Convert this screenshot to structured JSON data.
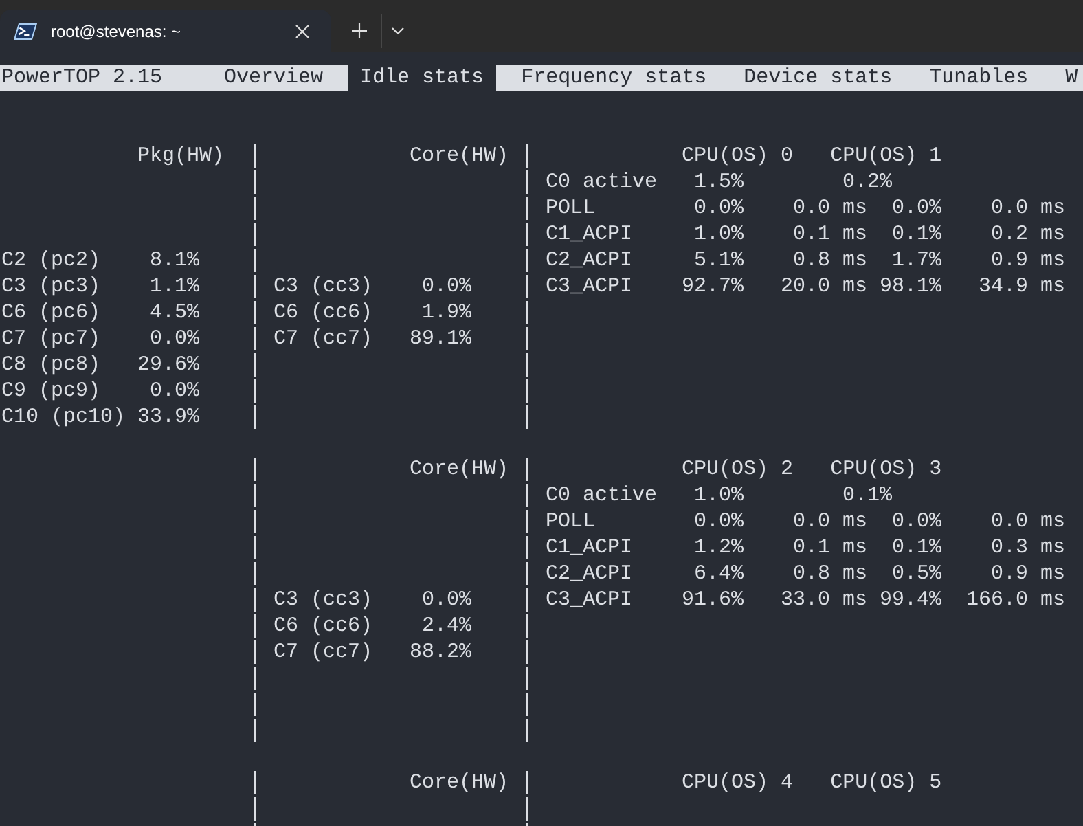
{
  "window": {
    "tabs": [
      {
        "title": "root@stevenas: ~",
        "selected": true
      }
    ]
  },
  "powertop": {
    "title": "PowerTOP 2.15",
    "tabs": [
      {
        "label": "Overview",
        "selected": false
      },
      {
        "label": "Idle stats",
        "selected": true
      },
      {
        "label": "Frequency stats",
        "selected": false
      },
      {
        "label": "Device stats",
        "selected": false
      },
      {
        "label": "Tunables",
        "selected": false
      },
      {
        "label": "W",
        "selected": false
      }
    ],
    "groups": [
      {
        "package": {
          "heading": "Pkg(HW)",
          "states": [
            {
              "name": "C2 (pc2)",
              "value": "8.1%"
            },
            {
              "name": "C3 (pc3)",
              "value": "1.1%"
            },
            {
              "name": "C6 (pc6)",
              "value": "4.5%"
            },
            {
              "name": "C7 (pc7)",
              "value": "0.0%"
            },
            {
              "name": "C8 (pc8)",
              "value": "29.6%"
            },
            {
              "name": "C9 (pc9)",
              "value": "0.0%"
            },
            {
              "name": "C10 (pc10)",
              "value": "33.9%"
            }
          ]
        },
        "core": {
          "heading": "Core(HW)",
          "states": [
            {
              "name": "C3 (cc3)",
              "value": "0.0%"
            },
            {
              "name": "C6 (cc6)",
              "value": "1.9%"
            },
            {
              "name": "C7 (cc7)",
              "value": "89.1%"
            }
          ]
        },
        "cpus": {
          "headings": [
            "CPU(OS) 0",
            "CPU(OS) 1"
          ],
          "states": [
            {
              "kind": "active",
              "name": "C0 active",
              "values": [
                "1.5%",
                "0.2%"
              ]
            },
            {
              "kind": "state",
              "name": "POLL",
              "values": [
                "0.0%",
                "0.0 ms",
                "0.0%",
                "0.0 ms"
              ]
            },
            {
              "kind": "state",
              "name": "C1_ACPI",
              "values": [
                "1.0%",
                "0.1 ms",
                "0.1%",
                "0.2 ms"
              ]
            },
            {
              "kind": "state",
              "name": "C2_ACPI",
              "values": [
                "5.1%",
                "0.8 ms",
                "1.7%",
                "0.9 ms"
              ]
            },
            {
              "kind": "state",
              "name": "C3_ACPI",
              "values": [
                "92.7%",
                "20.0 ms",
                "98.1%",
                "34.9 ms"
              ]
            }
          ]
        }
      },
      {
        "core": {
          "heading": "Core(HW)",
          "states": [
            {
              "name": "C3 (cc3)",
              "value": "0.0%"
            },
            {
              "name": "C6 (cc6)",
              "value": "2.4%"
            },
            {
              "name": "C7 (cc7)",
              "value": "88.2%"
            }
          ]
        },
        "cpus": {
          "headings": [
            "CPU(OS) 2",
            "CPU(OS) 3"
          ],
          "states": [
            {
              "kind": "active",
              "name": "C0 active",
              "values": [
                "1.0%",
                "0.1%"
              ]
            },
            {
              "kind": "state",
              "name": "POLL",
              "values": [
                "0.0%",
                "0.0 ms",
                "0.0%",
                "0.0 ms"
              ]
            },
            {
              "kind": "state",
              "name": "C1_ACPI",
              "values": [
                "1.2%",
                "0.1 ms",
                "0.1%",
                "0.3 ms"
              ]
            },
            {
              "kind": "state",
              "name": "C2_ACPI",
              "values": [
                "6.4%",
                "0.8 ms",
                "0.5%",
                "0.9 ms"
              ]
            },
            {
              "kind": "state",
              "name": "C3_ACPI",
              "values": [
                "91.6%",
                "33.0 ms",
                "99.4%",
                "166.0 ms"
              ]
            }
          ]
        }
      },
      {
        "core": {
          "heading": "Core(HW)"
        },
        "cpus": {
          "headings": [
            "CPU(OS) 4",
            "CPU(OS) 5"
          ]
        }
      }
    ]
  }
}
